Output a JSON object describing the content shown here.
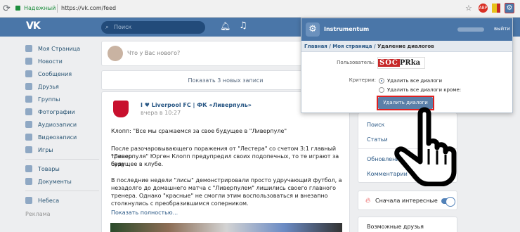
{
  "browser": {
    "secure_label": "Надежный",
    "url": "https://vk.com/feed",
    "ext_badge": "ABP"
  },
  "header": {
    "logo": "VK",
    "search_placeholder": "Поиск"
  },
  "sidebar": {
    "items": [
      {
        "label": "Моя Страница"
      },
      {
        "label": "Новости"
      },
      {
        "label": "Сообщения"
      },
      {
        "label": "Друзья"
      },
      {
        "label": "Группы"
      },
      {
        "label": "Фотографии"
      },
      {
        "label": "Аудиозаписи"
      },
      {
        "label": "Видеозаписи"
      },
      {
        "label": "Игры"
      }
    ],
    "items2": [
      {
        "label": "Товары"
      },
      {
        "label": "Документы"
      }
    ],
    "items3": [
      {
        "label": "Небеса"
      }
    ],
    "ads_label": "Реклама"
  },
  "feed": {
    "compose_placeholder": "Что у Вас нового?",
    "new_posts": "Показать 3 новых записи",
    "post": {
      "title": "I ♥ Liverpool FC | ФК «Ливерпуль»",
      "date": "вчера в 10:27",
      "p1": "Клопп: \"Все мы сражаемся за свое будущее в \"Ливерпуле\"",
      "p2a": "После разочаровывающего поражения от \"Лестера\" со счетом 3:1 главный тренер",
      "p2b": "\"Ливерпуля\" Юрген Клопп предупредил своих подопечных, то те играют за свое",
      "p2c": "будущее в клубе.",
      "p3a": "В последние недели \"лисы\" демонстрировали просто удручающий футбол, а",
      "p3b": "незадолго до домашнего матча с \"Ливерпулем\" лишились своего главного",
      "p3c": "тренера. Однако \"красные\" не смогли этим воспользоваться и внезапно",
      "p3d": "столкнулись с преобразившимся соперником.",
      "more": "Показать полностью..."
    }
  },
  "right": {
    "links": [
      "Поиск",
      "Статьи",
      "Обновления",
      "Комментарии"
    ],
    "interesting": "Сначала интересные",
    "interesting_on": true,
    "friends": "Возможные друзья"
  },
  "popup": {
    "app_name": "Instrumentum",
    "exit": "выйти",
    "crumb_main": "Главная",
    "crumb_page": "Моя страница",
    "crumb_current": "Удаление диалогов",
    "user_label": "Пользователь:",
    "logo_red": "SOC",
    "logo_dark": "PRka",
    "criteria_label": "Критерии:",
    "option_all": "Удалить все диалоги",
    "option_except": "Удалить все диалоги кроме:",
    "selected_option": "all",
    "delete_button": "Удалить диалоги"
  }
}
